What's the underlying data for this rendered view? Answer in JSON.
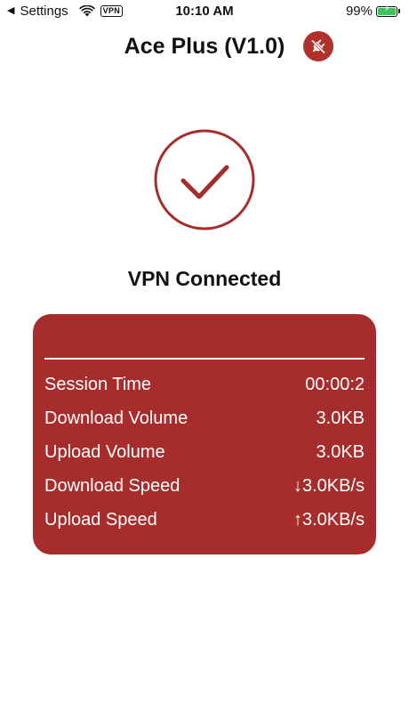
{
  "status_bar": {
    "back_caret": "◀",
    "back_label": "Settings",
    "vpn_badge": "VPN",
    "time": "10:10 AM",
    "battery_percent": "99%",
    "battery_level": 0.99,
    "icons": [
      "back-caret-icon",
      "wifi-icon",
      "battery-charging-icon"
    ]
  },
  "header": {
    "title": "Ace Plus (V1.0)",
    "disconnect_icon": "plug-off-icon"
  },
  "status": {
    "icon": "check-circle-icon",
    "text": "VPN Connected"
  },
  "stats": {
    "rows": [
      {
        "label": "Session Time",
        "value": "00:00:2"
      },
      {
        "label": "Download Volume",
        "value": "3.0KB"
      },
      {
        "label": "Upload Volume",
        "value": "3.0KB"
      },
      {
        "label": "Download Speed",
        "value": "↓3.0KB/s"
      },
      {
        "label": "Upload Speed",
        "value": "↑3.0KB/s"
      }
    ]
  },
  "colors": {
    "accent": "#a62d2b",
    "battery_green": "#35c759",
    "text": "#111111",
    "background": "#ffffff"
  }
}
